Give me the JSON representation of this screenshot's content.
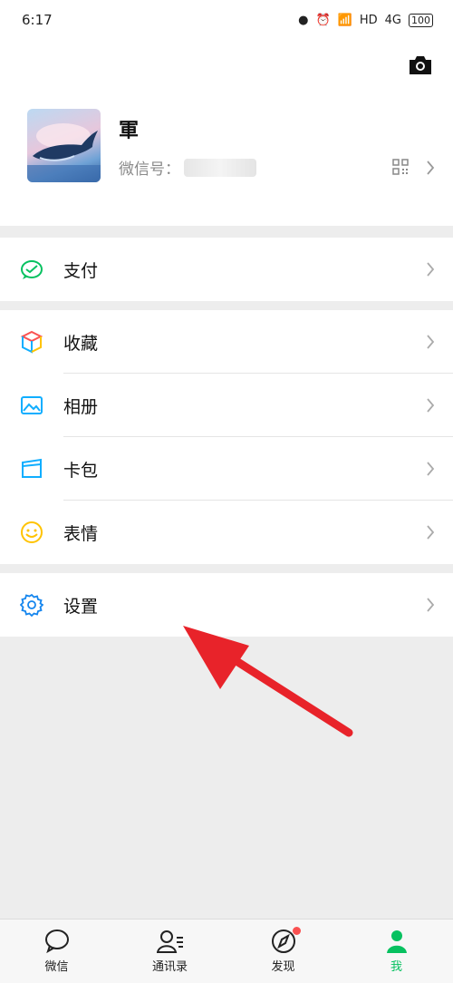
{
  "status_bar": {
    "time": "6:17",
    "network": "HD",
    "signal_label": "4G",
    "battery": "100"
  },
  "profile": {
    "nickname": "軍",
    "wechat_id_label": "微信号：",
    "wechat_id_value": "█████"
  },
  "menu": {
    "pay": "支付",
    "favorites": "收藏",
    "album": "相册",
    "cards": "卡包",
    "stickers": "表情",
    "settings": "设置"
  },
  "tabbar": {
    "chats": "微信",
    "contacts": "通讯录",
    "discover": "发现",
    "me": "我"
  },
  "colors": {
    "accent": "#07c160",
    "badge": "#fa5151",
    "annotation_arrow": "#e8232a"
  }
}
